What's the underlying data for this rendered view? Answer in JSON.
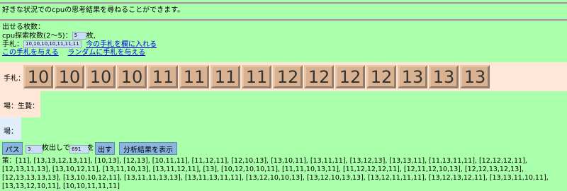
{
  "intro": "好きな状況でのcpuの思考結果を尋ねることができます。",
  "settings": {
    "play_count_label": "出せる枚数：",
    "cpu_label": "cpu探索枚数(2〜5)：",
    "cpu_value": "5",
    "cpu_unit": "枚,",
    "hand_label": "手札：",
    "hand_value": "10,10,10,10,11,11,11",
    "put_link": "今の手札を欄に入れる",
    "give_link": "この手札を与える",
    "random_link": "ランダムに手札を与える"
  },
  "hand_row": {
    "label": "手札：",
    "cards": [
      "10",
      "10",
      "10",
      "10",
      "11",
      "11",
      "11",
      "11",
      "12",
      "12",
      "12",
      "12",
      "13",
      "13",
      "13"
    ]
  },
  "field_revolution_label": "場：生贄：",
  "field_label": "場：",
  "controls": {
    "pass_label": "パス",
    "count_value": "3",
    "count_suffix": "枚出しで",
    "rank_value": "691",
    "rank_suffix": "を",
    "play_label": "出す",
    "analysis_label": "分析結果を表示"
  },
  "policy": "策：[11], [13,13,12,13,11], [10,13], [12,13], [10,11,11], [11,12,11], [12,10,13], [13,10,11], [13,11,11], [13,12,13], [13,13,11], [11,13,11,11], [12,12,12,11], [12,13,11,13], [13,10,12,11], [13,11,10,13], [13,11,12,11], [13], [10,12,10,10,11], [11,11,10,13,11], [11,12,12,12,11], [12,11,12,10,13], [12,12,13,12,13], [12,13,13,13,13], [13,10,10,12,11], [13,11,11,13,13], [13,11,13,11,11], [13,12,10,10,13], [13,12,10,13,13], [13,12,11,11,11], [13,12,13,12,11], [13,13,11,10,11], [13,13,12,10,11], [10,10,11,11,11]"
}
